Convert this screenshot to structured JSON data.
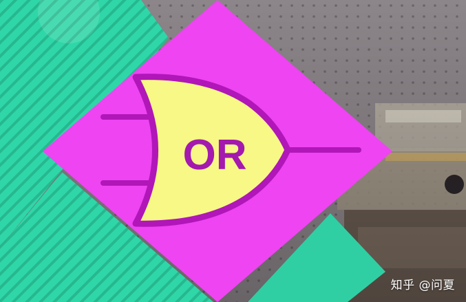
{
  "gate": {
    "label": "OR"
  },
  "watermark": {
    "text": "知乎 @问夏"
  },
  "colors": {
    "diamond": "#ee44f2",
    "gate_fill": "#f7f886",
    "gate_outline": "#b016b8",
    "green_panel": "#2fd6a8",
    "background": "#6f6a6e"
  }
}
